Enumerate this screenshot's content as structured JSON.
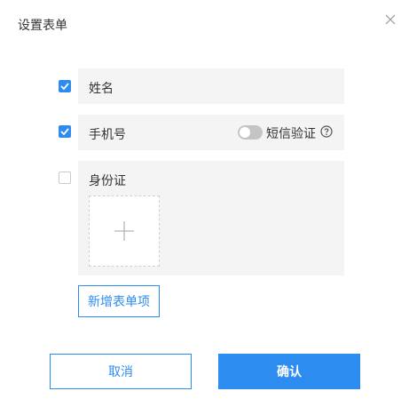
{
  "dialog": {
    "title": "设置表单",
    "close_icon": "close-icon"
  },
  "fields": [
    {
      "label": "姓名",
      "checked": true
    },
    {
      "label": "手机号",
      "checked": true,
      "sms_toggle_on": false,
      "sms_label": "短信验证",
      "help_icon": "question-circle-icon"
    },
    {
      "label": "身份证",
      "checked": false,
      "upload_icon": "plus-icon"
    }
  ],
  "add_button_label": "新增表单项",
  "footer": {
    "cancel_label": "取消",
    "confirm_label": "确认"
  },
  "colors": {
    "primary": "#2d8cf0",
    "field_bg": "#f4f4f4",
    "toggle_off": "#c4c4c4"
  }
}
